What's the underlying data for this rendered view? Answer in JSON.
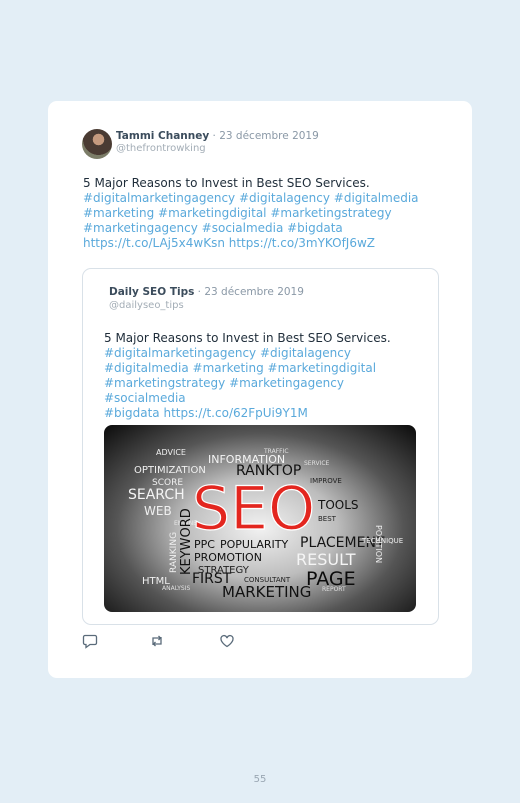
{
  "tweet": {
    "author_name": "Tammi Channey",
    "separator": " · ",
    "date": "23 décembre 2019",
    "handle": "@thefrontrowking",
    "text_lead": "5 Major Reasons to Invest in Best SEO Services.",
    "tags_line1": "#digitalmarketingagency #digitalagency #digitalmedia",
    "tags_line2": "#marketing #marketingdigital #marketingstrategy",
    "tags_line3": "#marketingagency #socialmedia #bigdata",
    "links_line": "https://t.co/LAj5x4wKsn https://t.co/3mYKOfJ6wZ"
  },
  "quote": {
    "author_name": "Daily SEO Tips",
    "separator": " · ",
    "date": "23 décembre 2019",
    "handle": "@dailyseo_tips",
    "text_lead": "5 Major Reasons to Invest in Best SEO Services.",
    "tags_line1": "#digitalmarketingagency #digitalagency",
    "tags_line2": "#digitalmedia #marketing #marketingdigital",
    "tags_line3": "#marketingstrategy #marketingagency #socialmedia",
    "tags_line4": "#bigdata https://t.co/62FpUi9Y1M",
    "image": {
      "center_word": "SEO",
      "words": [
        "OPTIMIZATION",
        "ADVICE",
        "INFORMATION",
        "RANKTOP",
        "IMPROVE",
        "ANALYSIS",
        "SCORE",
        "SEARCH",
        "WEB",
        "TOOLS",
        "KEYWORD",
        "RANKING",
        "POSITION",
        "TECHNIQUE",
        "PPC",
        "POPULARITY",
        "PLACEMENT",
        "PROMOTION",
        "RESULT",
        "STRATEGY",
        "PAGE",
        "HTML",
        "FIRST",
        "CONSULTANT",
        "MARKETING",
        "TRAFFIC",
        "ENGINE",
        "REPORT",
        "SERVICE",
        "BEST"
      ],
      "accent_color": "#e3261f"
    }
  },
  "actions": [
    {
      "icon": "reply-icon"
    },
    {
      "icon": "retweet-icon"
    },
    {
      "icon": "like-icon"
    }
  ],
  "page_number": "55",
  "colors": {
    "background": "#e3eef6",
    "card": "#ffffff",
    "link": "#5aa9db",
    "text": "#1f2d3a"
  }
}
